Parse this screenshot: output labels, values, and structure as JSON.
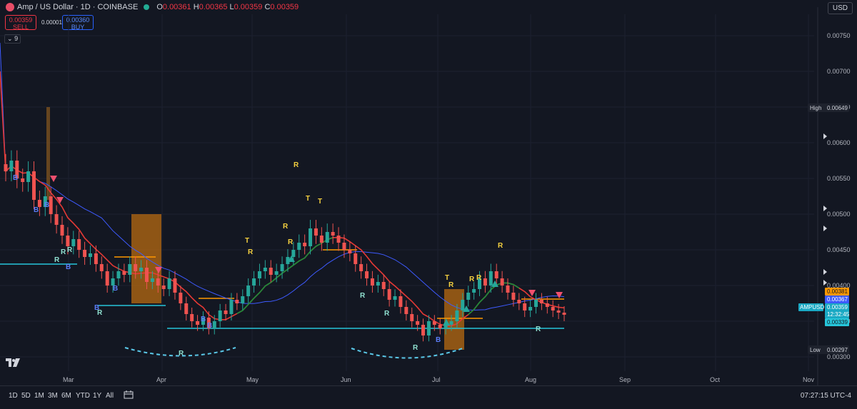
{
  "header": {
    "symbol_name": "Amp / US Dollar · 1D · COINBASE",
    "ohlc": [
      {
        "k": "O",
        "v": "0.00361"
      },
      {
        "k": "H",
        "v": "0.00365"
      },
      {
        "k": "L",
        "v": "0.00359"
      },
      {
        "k": "C",
        "v": "0.00359"
      }
    ]
  },
  "trade": {
    "sell_price": "0.00359",
    "sell_label": "SELL",
    "spread": "0.00001",
    "buy_price": "0.00360",
    "buy_label": "BUY"
  },
  "indicator_count": "9",
  "currency": "USD",
  "colors": {
    "bg": "#131722",
    "up": "#26a69a",
    "down": "#ef5350",
    "red_ma": "#e53935",
    "blue_ma": "#3d5afe",
    "orange": "#ff9800",
    "cyan": "#26c6da",
    "green_line": "#1b8f3a",
    "signal_yellow": "#f4d03f",
    "signal_blue": "#5b7cf7",
    "signal_teal": "#8fe0d0"
  },
  "chart_data": {
    "type": "candlestick",
    "symbol": "AMPUSD",
    "price_ticks": [
      "0.00750",
      "0.00700",
      "0.00650",
      "0.00600",
      "0.00550",
      "0.00500",
      "0.00450",
      "0.00400",
      "0.00350",
      "0.00300"
    ],
    "time_ticks": [
      "Mar",
      "Apr",
      "May",
      "Jun",
      "Jul",
      "Aug",
      "Sep",
      "Oct",
      "Nov"
    ],
    "ylim": [
      0.0028,
      0.0078
    ],
    "candles": [
      [
        0.0057,
        0.0056
      ],
      [
        0.0056,
        0.00575
      ],
      [
        0.00575,
        0.0055
      ],
      [
        0.0055,
        0.00545
      ],
      [
        0.00545,
        0.0056
      ],
      [
        0.0056,
        0.0052
      ],
      [
        0.0052,
        0.0051
      ],
      [
        0.0051,
        0.00525
      ],
      [
        0.00525,
        0.005
      ],
      [
        0.005,
        0.00485
      ],
      [
        0.00485,
        0.0047
      ],
      [
        0.0047,
        0.00455
      ],
      [
        0.00455,
        0.00465
      ],
      [
        0.00465,
        0.0045
      ],
      [
        0.0045,
        0.0044
      ],
      [
        0.0044,
        0.00445
      ],
      [
        0.00445,
        0.0043
      ],
      [
        0.0043,
        0.0042
      ],
      [
        0.0042,
        0.004
      ],
      [
        0.004,
        0.0041
      ],
      [
        0.0041,
        0.0042
      ],
      [
        0.0042,
        0.00415
      ],
      [
        0.00415,
        0.0043
      ],
      [
        0.0043,
        0.0042
      ],
      [
        0.0042,
        0.00425
      ],
      [
        0.00425,
        0.00405
      ],
      [
        0.00405,
        0.0041
      ],
      [
        0.0041,
        0.004
      ],
      [
        0.004,
        0.00395
      ],
      [
        0.00395,
        0.0041
      ],
      [
        0.0041,
        0.0039
      ],
      [
        0.0039,
        0.00375
      ],
      [
        0.00375,
        0.0036
      ],
      [
        0.0036,
        0.0035
      ],
      [
        0.0035,
        0.00345
      ],
      [
        0.00345,
        0.00355
      ],
      [
        0.00355,
        0.0034
      ],
      [
        0.0034,
        0.0035
      ],
      [
        0.0035,
        0.00365
      ],
      [
        0.00365,
        0.0036
      ],
      [
        0.0036,
        0.0038
      ],
      [
        0.0038,
        0.00375
      ],
      [
        0.00375,
        0.00385
      ],
      [
        0.00385,
        0.004
      ],
      [
        0.004,
        0.0041
      ],
      [
        0.0041,
        0.0042
      ],
      [
        0.0042,
        0.00425
      ],
      [
        0.00425,
        0.00415
      ],
      [
        0.00415,
        0.0042
      ],
      [
        0.0042,
        0.0043
      ],
      [
        0.0043,
        0.0044
      ],
      [
        0.0044,
        0.0045
      ],
      [
        0.0045,
        0.0046
      ],
      [
        0.0046,
        0.00455
      ],
      [
        0.00455,
        0.0048
      ],
      [
        0.0048,
        0.0047
      ],
      [
        0.0047,
        0.0046
      ],
      [
        0.0046,
        0.00475
      ],
      [
        0.00475,
        0.0047
      ],
      [
        0.0047,
        0.0046
      ],
      [
        0.0046,
        0.0045
      ],
      [
        0.0045,
        0.00445
      ],
      [
        0.00445,
        0.0043
      ],
      [
        0.0043,
        0.0042
      ],
      [
        0.0042,
        0.0041
      ],
      [
        0.0041,
        0.004
      ],
      [
        0.004,
        0.00405
      ],
      [
        0.00405,
        0.00395
      ],
      [
        0.00395,
        0.0038
      ],
      [
        0.0038,
        0.00385
      ],
      [
        0.00385,
        0.0037
      ],
      [
        0.0037,
        0.0036
      ],
      [
        0.0036,
        0.0035
      ],
      [
        0.0035,
        0.00345
      ],
      [
        0.00345,
        0.0033
      ],
      [
        0.0033,
        0.0035
      ],
      [
        0.0035,
        0.00345
      ],
      [
        0.00345,
        0.0034
      ],
      [
        0.0034,
        0.00345
      ],
      [
        0.00345,
        0.0035
      ],
      [
        0.0035,
        0.00365
      ],
      [
        0.00365,
        0.0038
      ],
      [
        0.0038,
        0.0039
      ],
      [
        0.0039,
        0.00395
      ],
      [
        0.00395,
        0.0041
      ],
      [
        0.0041,
        0.004
      ],
      [
        0.004,
        0.0042
      ],
      [
        0.0042,
        0.0041
      ],
      [
        0.0041,
        0.004
      ],
      [
        0.004,
        0.0039
      ],
      [
        0.0039,
        0.0038
      ],
      [
        0.0038,
        0.00375
      ],
      [
        0.00375,
        0.00365
      ],
      [
        0.00365,
        0.0037
      ],
      [
        0.0037,
        0.0038
      ],
      [
        0.0038,
        0.00375
      ],
      [
        0.00375,
        0.0037
      ],
      [
        0.0037,
        0.00365
      ],
      [
        0.00365,
        0.00362
      ],
      [
        0.00362,
        0.00359
      ]
    ],
    "labels": {
      "high_label": "High",
      "high_value": "0.00649",
      "low_label": "Low",
      "low_value": "0.00297",
      "orange_level": "0.00381",
      "blue_level": "0.00367",
      "symbol_tag": "AMPUSD",
      "last_price": "0.00359",
      "countdown": "12:32:45",
      "cyan_level": "0.00339"
    }
  },
  "timeframes": [
    "1D",
    "5D",
    "1M",
    "3M",
    "6M",
    "YTD",
    "1Y",
    "All"
  ],
  "clock": "07:27:15 UTC-4"
}
